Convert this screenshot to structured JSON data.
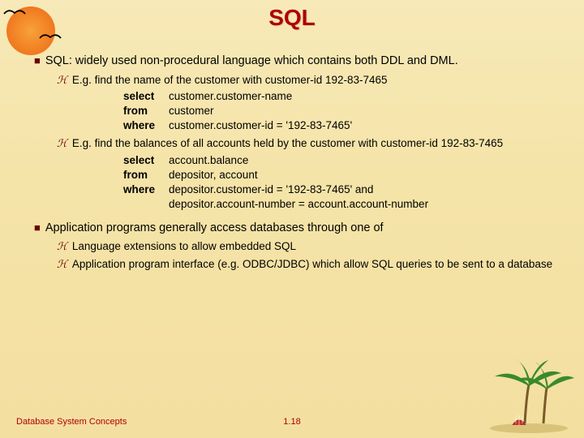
{
  "title": "SQL",
  "b1": {
    "text": "SQL: widely used non-procedural language which contains both DDL and DML.",
    "ex1": {
      "text": "E.g. find the name of the customer with customer-id 192-83-7465",
      "select": "select",
      "select_v": "customer.customer-name",
      "from": "from",
      "from_v": "customer",
      "where": "where",
      "where_v": "customer.customer-id = '192-83-7465'"
    },
    "ex2": {
      "text": "E.g. find the balances of all accounts held by the customer with customer-id 192-83-7465",
      "select": "select",
      "select_v": "account.balance",
      "from": "from",
      "from_v": "depositor, account",
      "where": "where",
      "where_v": "depositor.customer-id = '192-83-7465' and",
      "where2": "depositor.account-number = account.account-number"
    }
  },
  "b2": {
    "text": "Application programs generally access databases through one of",
    "s1": "Language extensions to allow embedded SQL",
    "s2": "Application program interface (e.g. ODBC/JDBC) which allow SQL queries to be sent to a database"
  },
  "footer": {
    "left": "Database System Concepts",
    "center": "1.18"
  }
}
